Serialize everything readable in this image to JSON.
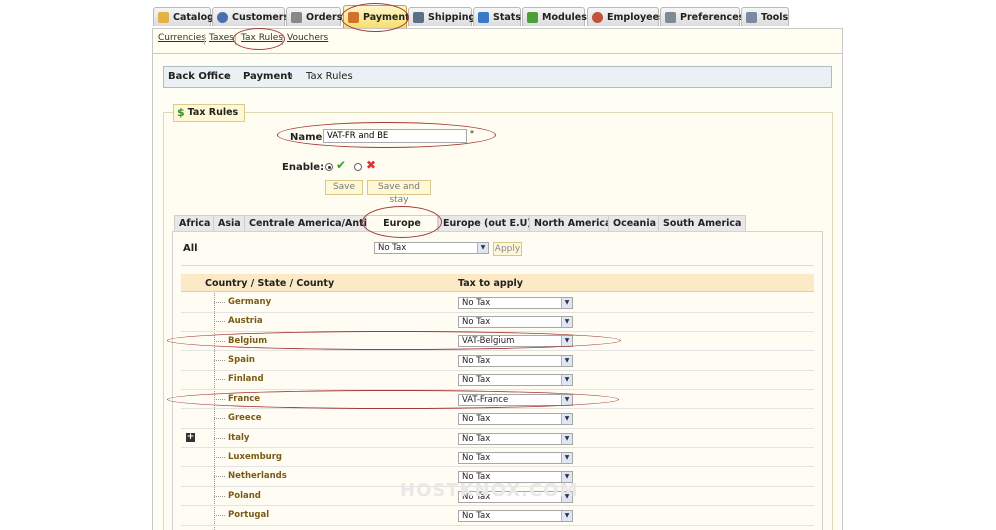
{
  "top_tabs": [
    {
      "label": "Catalog",
      "icon": "folder-icon",
      "color": "#e3b445"
    },
    {
      "label": "Customers",
      "icon": "user-icon",
      "color": "#4a6fb0"
    },
    {
      "label": "Orders",
      "icon": "cart-icon",
      "color": "#888888"
    },
    {
      "label": "Payment",
      "icon": "payment-icon",
      "color": "#d0722a"
    },
    {
      "label": "Shipping",
      "icon": "truck-icon",
      "color": "#5d6f86"
    },
    {
      "label": "Stats",
      "icon": "chart-icon",
      "color": "#3a78c8"
    },
    {
      "label": "Modules",
      "icon": "puzzle-icon",
      "color": "#4c9e3a"
    },
    {
      "label": "Employees",
      "icon": "employee-icon",
      "color": "#c0533a"
    },
    {
      "label": "Preferences",
      "icon": "preferences-icon",
      "color": "#7e8a96"
    },
    {
      "label": "Tools",
      "icon": "wrench-icon",
      "color": "#7a8aa0"
    }
  ],
  "sub_nav": [
    "Currencies",
    "Taxes",
    "Tax Rules",
    "Vouchers"
  ],
  "breadcrumb": [
    "Back Office",
    "Payment",
    "Tax Rules"
  ],
  "fieldset": {
    "legend": "Tax Rules",
    "icon": "dollar-icon"
  },
  "form": {
    "name_label": "Name",
    "name_value": "VAT-FR and BE",
    "required_mark": "*",
    "enable_label": "Enable:",
    "save_label": "Save",
    "save_stay_label": "Save and stay"
  },
  "region_tabs": [
    "Africa",
    "Asia",
    "Centrale America/Antilla",
    "Europe",
    "Europe (out E.U)",
    "North America",
    "Oceania",
    "South America"
  ],
  "active_region": "Europe",
  "all_row": {
    "label": "All",
    "select_value": "No Tax",
    "apply_label": "Apply"
  },
  "table": {
    "columns": [
      "Country / State / County",
      "Tax to apply"
    ],
    "rows": [
      {
        "country": "Germany",
        "tax": "No Tax"
      },
      {
        "country": "Austria",
        "tax": "No Tax"
      },
      {
        "country": "Belgium",
        "tax": "VAT-Belgium"
      },
      {
        "country": "Spain",
        "tax": "No Tax"
      },
      {
        "country": "Finland",
        "tax": "No Tax"
      },
      {
        "country": "France",
        "tax": "VAT-France"
      },
      {
        "country": "Greece",
        "tax": "No Tax"
      },
      {
        "country": "Italy",
        "tax": "No Tax"
      },
      {
        "country": "Luxemburg",
        "tax": "No Tax"
      },
      {
        "country": "Netherlands",
        "tax": "No Tax"
      },
      {
        "country": "Poland",
        "tax": "No Tax"
      },
      {
        "country": "Portugal",
        "tax": "No Tax"
      }
    ]
  },
  "watermark": "HOSTKNOX.COM"
}
